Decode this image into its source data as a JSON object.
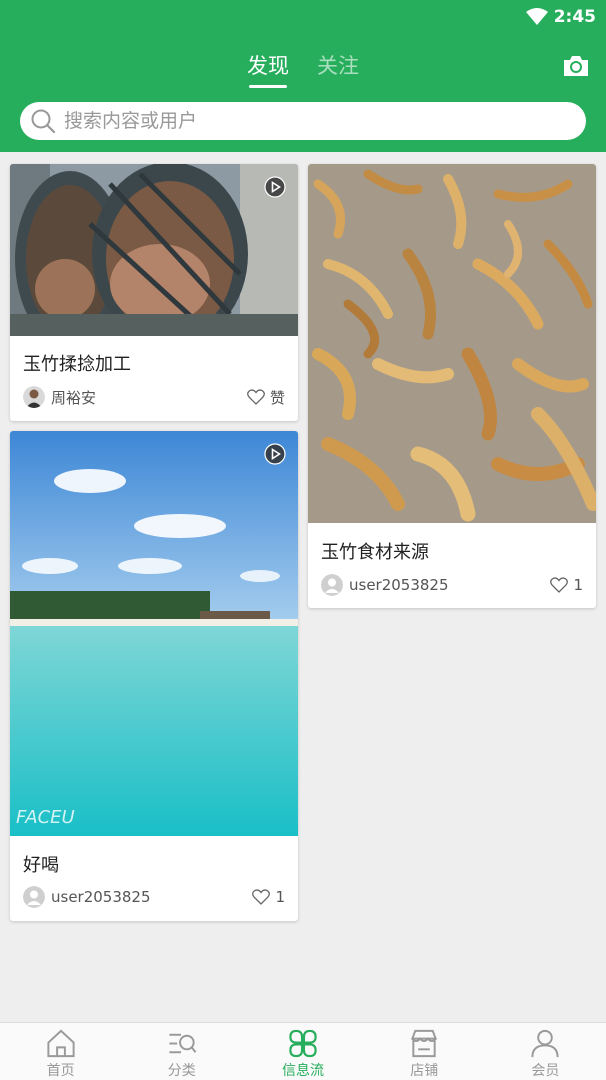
{
  "status": {
    "time": "2:45"
  },
  "tabs": [
    {
      "label": "发现",
      "active": true
    },
    {
      "label": "关注",
      "active": false
    }
  ],
  "search": {
    "placeholder": "搜索内容或用户"
  },
  "cards": [
    {
      "title": "玉竹揉捻加工",
      "author": "周裕安",
      "like_label": "赞",
      "has_video": true
    },
    {
      "title": "玉竹食材来源",
      "author": "user2053825",
      "like_label": "1",
      "has_video": false
    },
    {
      "title": "好喝",
      "author": "user2053825",
      "like_label": "1",
      "has_video": true,
      "watermark": "FACEU"
    }
  ],
  "bottom_nav": [
    {
      "label": "首页",
      "icon": "home-icon",
      "active": false
    },
    {
      "label": "分类",
      "icon": "category-search-icon",
      "active": false
    },
    {
      "label": "信息流",
      "icon": "feed-icon",
      "active": true
    },
    {
      "label": "店铺",
      "icon": "store-icon",
      "active": false
    },
    {
      "label": "会员",
      "icon": "member-icon",
      "active": false
    }
  ],
  "colors": {
    "brand": "#27ae5d",
    "background": "#eeeeee"
  }
}
